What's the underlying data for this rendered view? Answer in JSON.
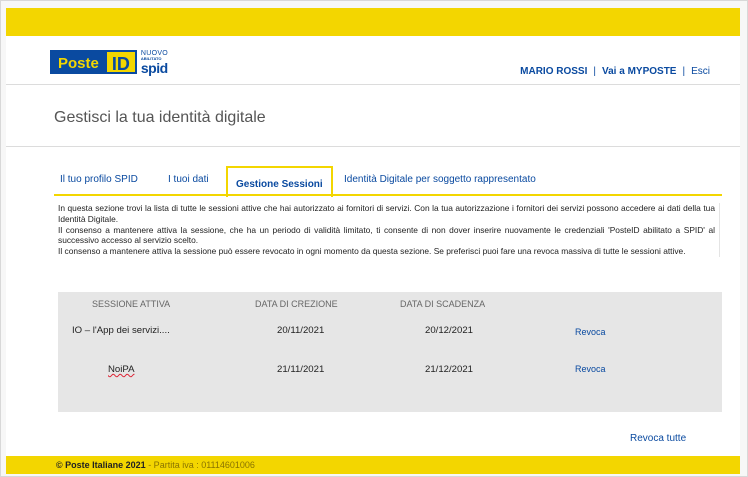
{
  "header": {
    "logo": {
      "poste": "Poste",
      "id": "ID",
      "nuovo": "NUOVO",
      "abilitato": "ABILITATO",
      "spid": "spid"
    },
    "user_name": "MARIO ROSSI",
    "separator": "|",
    "myposte_link": "Vai a MYPOSTE",
    "logout_link": "Esci"
  },
  "page_title": "Gestisci la tua identità digitale",
  "tabs": [
    {
      "label": "Il tuo profilo SPID",
      "active": false
    },
    {
      "label": "I tuoi dati",
      "active": false
    },
    {
      "label": "Gestione Sessioni",
      "active": true
    },
    {
      "label": "Identità Digitale per soggetto rappresentato",
      "active": false
    }
  ],
  "info_text": "In questa sezione trovi la lista di tutte le sessioni attive che hai autorizzato ai fornitori di servizi. Con la tua autorizzazione i fornitori dei servizi possono accedere ai dati della tua Identità Digitale.\nIl consenso a mantenere attiva la sessione, che ha un periodo di validità limitato, ti consente di non dover inserire nuovamente le credenziali 'PosteID abilitato a SPID' al successivo accesso al servizio scelto.\nIl consenso a mantenere attiva la sessione può essere revocato in ogni momento da questa sezione. Se preferisci puoi fare una revoca massiva di tutte le sessioni attive.",
  "sessions": {
    "columns": [
      "SESSIONE ATTIVA",
      "DATA DI CREZIONE",
      "DATA DI SCADENZA"
    ],
    "rows": [
      {
        "name": "IO – l'App dei servizi....",
        "created": "20/11/2021",
        "expires": "20/12/2021",
        "action": "Revoca"
      },
      {
        "name": "NoiPA",
        "created": "21/11/2021",
        "expires": "21/12/2021",
        "action": "Revoca"
      }
    ]
  },
  "revoke_all": "Revoca tutte",
  "footer": {
    "copyright": "© Poste Italiane 2021",
    "vat": " - Partita iva : 01114601006"
  },
  "colors": {
    "brand_yellow": "#f3d600",
    "brand_blue": "#0a4aa0",
    "panel_gray": "#e6e6e6"
  }
}
